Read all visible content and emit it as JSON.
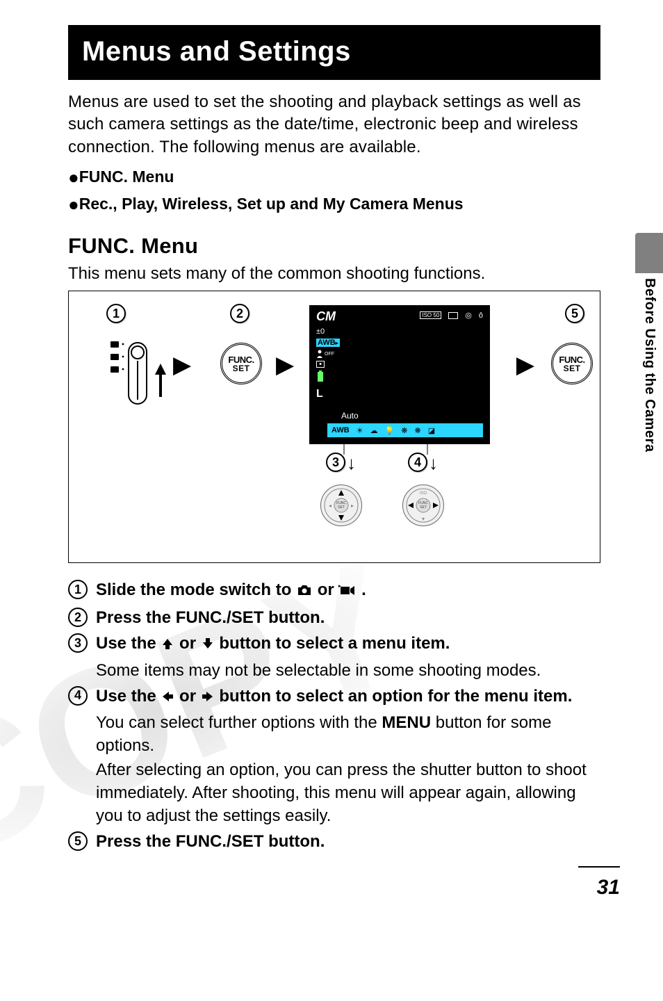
{
  "header": {
    "title": "Menus and Settings"
  },
  "intro": "Menus are used to set the shooting and playback settings as well as such camera settings as the date/time, electronic beep and wireless connection. The following menus are available.",
  "bullets": {
    "b1": "FUNC. Menu",
    "b2": "Rec., Play, Wireless, Set up and My Camera Menus"
  },
  "section": {
    "heading": "FUNC. Menu",
    "sub": "This menu sets many of the common shooting functions."
  },
  "diagram": {
    "labels": {
      "n1": "1",
      "n2": "2",
      "n3": "3",
      "n4": "4",
      "n5": "5"
    },
    "func_top": "FUNC.",
    "func_bot": "SET",
    "screen": {
      "topright_iso": "ISO 50",
      "ev": "±0",
      "awb": "AWB",
      "off": "OFF",
      "mode_label": "Auto",
      "size": "L",
      "cm": "CM",
      "wb_row": "AWB"
    }
  },
  "steps": {
    "s1": {
      "n": "1",
      "line_a": "Slide the mode switch to ",
      "line_b": " or ",
      "line_c": "."
    },
    "s2": {
      "n": "2",
      "line": "Press the FUNC./SET button."
    },
    "s3": {
      "n": "3",
      "line_a": "Use the ",
      "line_b": " or ",
      "line_c": "  button to select a menu item.",
      "note": "Some items may not be selectable in some shooting modes."
    },
    "s4": {
      "n": "4",
      "line_a": "Use the ",
      "line_b": " or ",
      "line_c": "  button to select an option for the menu item.",
      "note1": "You can select further options with the ",
      "menu": "MENU",
      "note1b": " button for some options.",
      "note2": "After selecting an option, you can press the shutter button to shoot immediately. After shooting, this menu will appear again, allowing you to adjust the settings easily."
    },
    "s5": {
      "n": "5",
      "line": "Press the FUNC./SET button."
    }
  },
  "side": {
    "tab_text": "Before Using the Camera"
  },
  "page": {
    "number": "31"
  }
}
